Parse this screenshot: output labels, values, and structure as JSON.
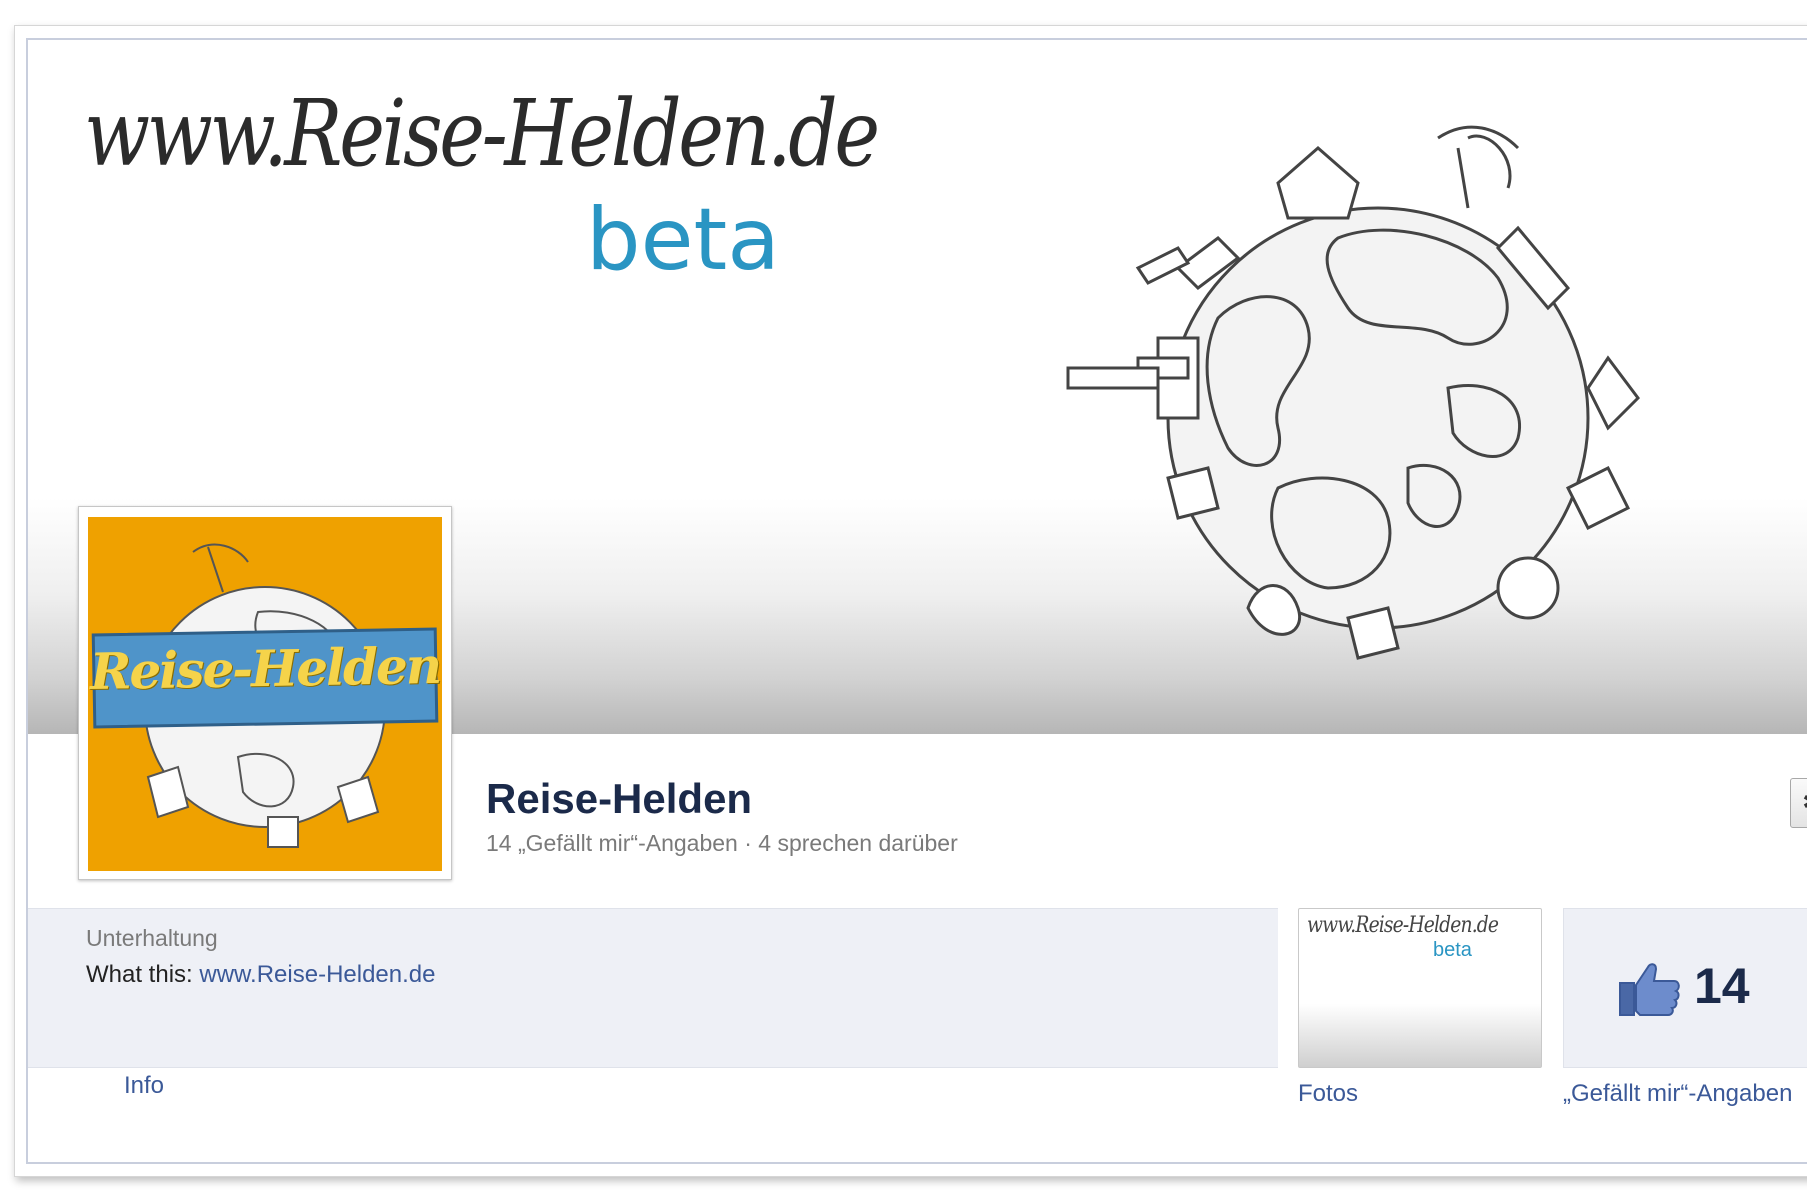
{
  "cover": {
    "logo_text": "www.Reise-Helden.de",
    "beta_text": "beta"
  },
  "profile": {
    "badge_text": "Reise-Helden"
  },
  "page": {
    "name": "Reise-Helden",
    "stats": "14 „Gefällt mir“-Angaben · 4 sprechen darüber"
  },
  "about": {
    "category": "Unterhaltung",
    "what_label": "What this: ",
    "website": "www.Reise-Helden.de"
  },
  "tabs": {
    "info": "Info"
  },
  "apps": {
    "photos_thumb_logo": "www.Reise-Helden.de",
    "photos_thumb_beta": "beta",
    "photos_label": "Fotos",
    "likes_count": "14",
    "likes_label": "„Gefällt mir“-Angaben"
  },
  "icons": {
    "gear": "gear-icon",
    "thumbs_up": "thumbs-up-icon"
  },
  "colors": {
    "link": "#3b5998",
    "beta": "#2a95c3",
    "profile_bg": "#efa100",
    "banner_blue": "#4f94c9",
    "banner_text": "#f5d34a"
  }
}
